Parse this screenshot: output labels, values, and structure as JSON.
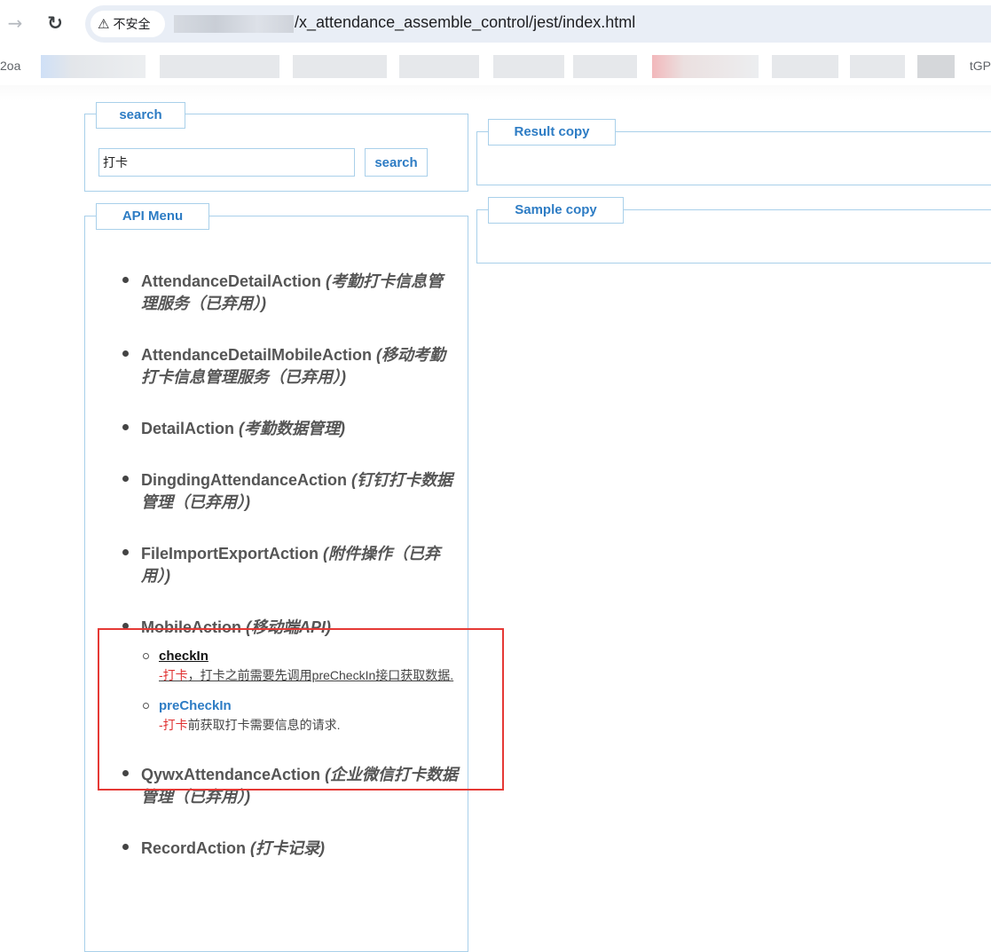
{
  "browser": {
    "security_label": "不安全",
    "url_path": "/x_attendance_assemble_control/jest/index.html",
    "bookmark_edge_left": "2oa",
    "bookmark_edge_right": "tGP"
  },
  "search_panel": {
    "legend": "search",
    "input_value": "打卡",
    "button_label": "search"
  },
  "result_panel": {
    "legend": "Result copy"
  },
  "sample_panel": {
    "legend": "Sample copy"
  },
  "api_menu": {
    "legend": "API Menu",
    "items": [
      {
        "name": "AttendanceDetailAction",
        "desc": "(考勤打卡信息管理服务（已弃用）)"
      },
      {
        "name": "AttendanceDetailMobileAction",
        "desc": "(移动考勤打卡信息管理服务（已弃用）)"
      },
      {
        "name": "DetailAction",
        "desc": "(考勤数据管理)"
      },
      {
        "name": "DingdingAttendanceAction",
        "desc": "(钉钉打卡数据管理（已弃用）)"
      },
      {
        "name": "FileImportExportAction",
        "desc": "(附件操作（已弃用）)"
      },
      {
        "name": "MobileAction",
        "desc": "(移动端API)",
        "children": [
          {
            "name": "checkIn",
            "desc_highlight": "-打卡",
            "desc_rest": "，打卡之前需要先调用preCheckIn接口获取数据."
          },
          {
            "name": "preCheckIn",
            "desc_highlight": "-打卡",
            "desc_rest": "前获取打卡需要信息的请求."
          }
        ]
      },
      {
        "name": "QywxAttendanceAction",
        "desc": "(企业微信打卡数据管理（已弃用）)"
      },
      {
        "name": "RecordAction",
        "desc": "(打卡记录)"
      }
    ]
  },
  "colors": {
    "accent": "#2d7cc4",
    "panel_border": "#a9d0ea",
    "highlight": "#e03030",
    "annotation_box": "#e53935"
  }
}
